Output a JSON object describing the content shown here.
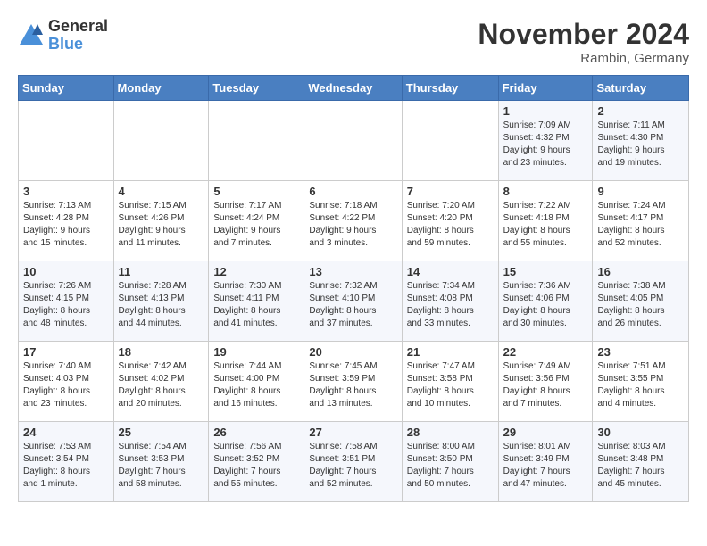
{
  "header": {
    "logo": {
      "general": "General",
      "blue": "Blue"
    },
    "title": "November 2024",
    "location": "Rambin, Germany"
  },
  "calendar": {
    "days_of_week": [
      "Sunday",
      "Monday",
      "Tuesday",
      "Wednesday",
      "Thursday",
      "Friday",
      "Saturday"
    ],
    "weeks": [
      [
        {
          "day": "",
          "info": ""
        },
        {
          "day": "",
          "info": ""
        },
        {
          "day": "",
          "info": ""
        },
        {
          "day": "",
          "info": ""
        },
        {
          "day": "",
          "info": ""
        },
        {
          "day": "1",
          "info": "Sunrise: 7:09 AM\nSunset: 4:32 PM\nDaylight: 9 hours\nand 23 minutes."
        },
        {
          "day": "2",
          "info": "Sunrise: 7:11 AM\nSunset: 4:30 PM\nDaylight: 9 hours\nand 19 minutes."
        }
      ],
      [
        {
          "day": "3",
          "info": "Sunrise: 7:13 AM\nSunset: 4:28 PM\nDaylight: 9 hours\nand 15 minutes."
        },
        {
          "day": "4",
          "info": "Sunrise: 7:15 AM\nSunset: 4:26 PM\nDaylight: 9 hours\nand 11 minutes."
        },
        {
          "day": "5",
          "info": "Sunrise: 7:17 AM\nSunset: 4:24 PM\nDaylight: 9 hours\nand 7 minutes."
        },
        {
          "day": "6",
          "info": "Sunrise: 7:18 AM\nSunset: 4:22 PM\nDaylight: 9 hours\nand 3 minutes."
        },
        {
          "day": "7",
          "info": "Sunrise: 7:20 AM\nSunset: 4:20 PM\nDaylight: 8 hours\nand 59 minutes."
        },
        {
          "day": "8",
          "info": "Sunrise: 7:22 AM\nSunset: 4:18 PM\nDaylight: 8 hours\nand 55 minutes."
        },
        {
          "day": "9",
          "info": "Sunrise: 7:24 AM\nSunset: 4:17 PM\nDaylight: 8 hours\nand 52 minutes."
        }
      ],
      [
        {
          "day": "10",
          "info": "Sunrise: 7:26 AM\nSunset: 4:15 PM\nDaylight: 8 hours\nand 48 minutes."
        },
        {
          "day": "11",
          "info": "Sunrise: 7:28 AM\nSunset: 4:13 PM\nDaylight: 8 hours\nand 44 minutes."
        },
        {
          "day": "12",
          "info": "Sunrise: 7:30 AM\nSunset: 4:11 PM\nDaylight: 8 hours\nand 41 minutes."
        },
        {
          "day": "13",
          "info": "Sunrise: 7:32 AM\nSunset: 4:10 PM\nDaylight: 8 hours\nand 37 minutes."
        },
        {
          "day": "14",
          "info": "Sunrise: 7:34 AM\nSunset: 4:08 PM\nDaylight: 8 hours\nand 33 minutes."
        },
        {
          "day": "15",
          "info": "Sunrise: 7:36 AM\nSunset: 4:06 PM\nDaylight: 8 hours\nand 30 minutes."
        },
        {
          "day": "16",
          "info": "Sunrise: 7:38 AM\nSunset: 4:05 PM\nDaylight: 8 hours\nand 26 minutes."
        }
      ],
      [
        {
          "day": "17",
          "info": "Sunrise: 7:40 AM\nSunset: 4:03 PM\nDaylight: 8 hours\nand 23 minutes."
        },
        {
          "day": "18",
          "info": "Sunrise: 7:42 AM\nSunset: 4:02 PM\nDaylight: 8 hours\nand 20 minutes."
        },
        {
          "day": "19",
          "info": "Sunrise: 7:44 AM\nSunset: 4:00 PM\nDaylight: 8 hours\nand 16 minutes."
        },
        {
          "day": "20",
          "info": "Sunrise: 7:45 AM\nSunset: 3:59 PM\nDaylight: 8 hours\nand 13 minutes."
        },
        {
          "day": "21",
          "info": "Sunrise: 7:47 AM\nSunset: 3:58 PM\nDaylight: 8 hours\nand 10 minutes."
        },
        {
          "day": "22",
          "info": "Sunrise: 7:49 AM\nSunset: 3:56 PM\nDaylight: 8 hours\nand 7 minutes."
        },
        {
          "day": "23",
          "info": "Sunrise: 7:51 AM\nSunset: 3:55 PM\nDaylight: 8 hours\nand 4 minutes."
        }
      ],
      [
        {
          "day": "24",
          "info": "Sunrise: 7:53 AM\nSunset: 3:54 PM\nDaylight: 8 hours\nand 1 minute."
        },
        {
          "day": "25",
          "info": "Sunrise: 7:54 AM\nSunset: 3:53 PM\nDaylight: 7 hours\nand 58 minutes."
        },
        {
          "day": "26",
          "info": "Sunrise: 7:56 AM\nSunset: 3:52 PM\nDaylight: 7 hours\nand 55 minutes."
        },
        {
          "day": "27",
          "info": "Sunrise: 7:58 AM\nSunset: 3:51 PM\nDaylight: 7 hours\nand 52 minutes."
        },
        {
          "day": "28",
          "info": "Sunrise: 8:00 AM\nSunset: 3:50 PM\nDaylight: 7 hours\nand 50 minutes."
        },
        {
          "day": "29",
          "info": "Sunrise: 8:01 AM\nSunset: 3:49 PM\nDaylight: 7 hours\nand 47 minutes."
        },
        {
          "day": "30",
          "info": "Sunrise: 8:03 AM\nSunset: 3:48 PM\nDaylight: 7 hours\nand 45 minutes."
        }
      ]
    ]
  }
}
